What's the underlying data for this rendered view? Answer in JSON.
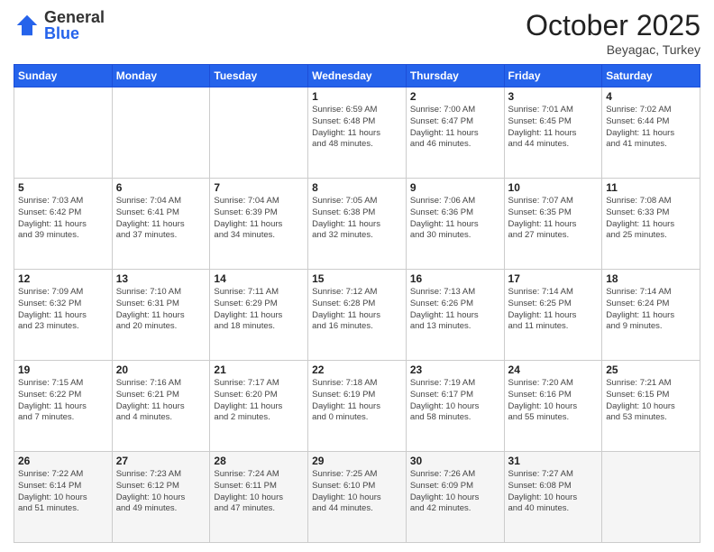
{
  "header": {
    "logo_general": "General",
    "logo_blue": "Blue",
    "month": "October 2025",
    "location": "Beyagac, Turkey"
  },
  "weekdays": [
    "Sunday",
    "Monday",
    "Tuesday",
    "Wednesday",
    "Thursday",
    "Friday",
    "Saturday"
  ],
  "weeks": [
    [
      {
        "day": "",
        "info": ""
      },
      {
        "day": "",
        "info": ""
      },
      {
        "day": "",
        "info": ""
      },
      {
        "day": "1",
        "info": "Sunrise: 6:59 AM\nSunset: 6:48 PM\nDaylight: 11 hours\nand 48 minutes."
      },
      {
        "day": "2",
        "info": "Sunrise: 7:00 AM\nSunset: 6:47 PM\nDaylight: 11 hours\nand 46 minutes."
      },
      {
        "day": "3",
        "info": "Sunrise: 7:01 AM\nSunset: 6:45 PM\nDaylight: 11 hours\nand 44 minutes."
      },
      {
        "day": "4",
        "info": "Sunrise: 7:02 AM\nSunset: 6:44 PM\nDaylight: 11 hours\nand 41 minutes."
      }
    ],
    [
      {
        "day": "5",
        "info": "Sunrise: 7:03 AM\nSunset: 6:42 PM\nDaylight: 11 hours\nand 39 minutes."
      },
      {
        "day": "6",
        "info": "Sunrise: 7:04 AM\nSunset: 6:41 PM\nDaylight: 11 hours\nand 37 minutes."
      },
      {
        "day": "7",
        "info": "Sunrise: 7:04 AM\nSunset: 6:39 PM\nDaylight: 11 hours\nand 34 minutes."
      },
      {
        "day": "8",
        "info": "Sunrise: 7:05 AM\nSunset: 6:38 PM\nDaylight: 11 hours\nand 32 minutes."
      },
      {
        "day": "9",
        "info": "Sunrise: 7:06 AM\nSunset: 6:36 PM\nDaylight: 11 hours\nand 30 minutes."
      },
      {
        "day": "10",
        "info": "Sunrise: 7:07 AM\nSunset: 6:35 PM\nDaylight: 11 hours\nand 27 minutes."
      },
      {
        "day": "11",
        "info": "Sunrise: 7:08 AM\nSunset: 6:33 PM\nDaylight: 11 hours\nand 25 minutes."
      }
    ],
    [
      {
        "day": "12",
        "info": "Sunrise: 7:09 AM\nSunset: 6:32 PM\nDaylight: 11 hours\nand 23 minutes."
      },
      {
        "day": "13",
        "info": "Sunrise: 7:10 AM\nSunset: 6:31 PM\nDaylight: 11 hours\nand 20 minutes."
      },
      {
        "day": "14",
        "info": "Sunrise: 7:11 AM\nSunset: 6:29 PM\nDaylight: 11 hours\nand 18 minutes."
      },
      {
        "day": "15",
        "info": "Sunrise: 7:12 AM\nSunset: 6:28 PM\nDaylight: 11 hours\nand 16 minutes."
      },
      {
        "day": "16",
        "info": "Sunrise: 7:13 AM\nSunset: 6:26 PM\nDaylight: 11 hours\nand 13 minutes."
      },
      {
        "day": "17",
        "info": "Sunrise: 7:14 AM\nSunset: 6:25 PM\nDaylight: 11 hours\nand 11 minutes."
      },
      {
        "day": "18",
        "info": "Sunrise: 7:14 AM\nSunset: 6:24 PM\nDaylight: 11 hours\nand 9 minutes."
      }
    ],
    [
      {
        "day": "19",
        "info": "Sunrise: 7:15 AM\nSunset: 6:22 PM\nDaylight: 11 hours\nand 7 minutes."
      },
      {
        "day": "20",
        "info": "Sunrise: 7:16 AM\nSunset: 6:21 PM\nDaylight: 11 hours\nand 4 minutes."
      },
      {
        "day": "21",
        "info": "Sunrise: 7:17 AM\nSunset: 6:20 PM\nDaylight: 11 hours\nand 2 minutes."
      },
      {
        "day": "22",
        "info": "Sunrise: 7:18 AM\nSunset: 6:19 PM\nDaylight: 11 hours\nand 0 minutes."
      },
      {
        "day": "23",
        "info": "Sunrise: 7:19 AM\nSunset: 6:17 PM\nDaylight: 10 hours\nand 58 minutes."
      },
      {
        "day": "24",
        "info": "Sunrise: 7:20 AM\nSunset: 6:16 PM\nDaylight: 10 hours\nand 55 minutes."
      },
      {
        "day": "25",
        "info": "Sunrise: 7:21 AM\nSunset: 6:15 PM\nDaylight: 10 hours\nand 53 minutes."
      }
    ],
    [
      {
        "day": "26",
        "info": "Sunrise: 7:22 AM\nSunset: 6:14 PM\nDaylight: 10 hours\nand 51 minutes."
      },
      {
        "day": "27",
        "info": "Sunrise: 7:23 AM\nSunset: 6:12 PM\nDaylight: 10 hours\nand 49 minutes."
      },
      {
        "day": "28",
        "info": "Sunrise: 7:24 AM\nSunset: 6:11 PM\nDaylight: 10 hours\nand 47 minutes."
      },
      {
        "day": "29",
        "info": "Sunrise: 7:25 AM\nSunset: 6:10 PM\nDaylight: 10 hours\nand 44 minutes."
      },
      {
        "day": "30",
        "info": "Sunrise: 7:26 AM\nSunset: 6:09 PM\nDaylight: 10 hours\nand 42 minutes."
      },
      {
        "day": "31",
        "info": "Sunrise: 7:27 AM\nSunset: 6:08 PM\nDaylight: 10 hours\nand 40 minutes."
      },
      {
        "day": "",
        "info": ""
      }
    ]
  ]
}
